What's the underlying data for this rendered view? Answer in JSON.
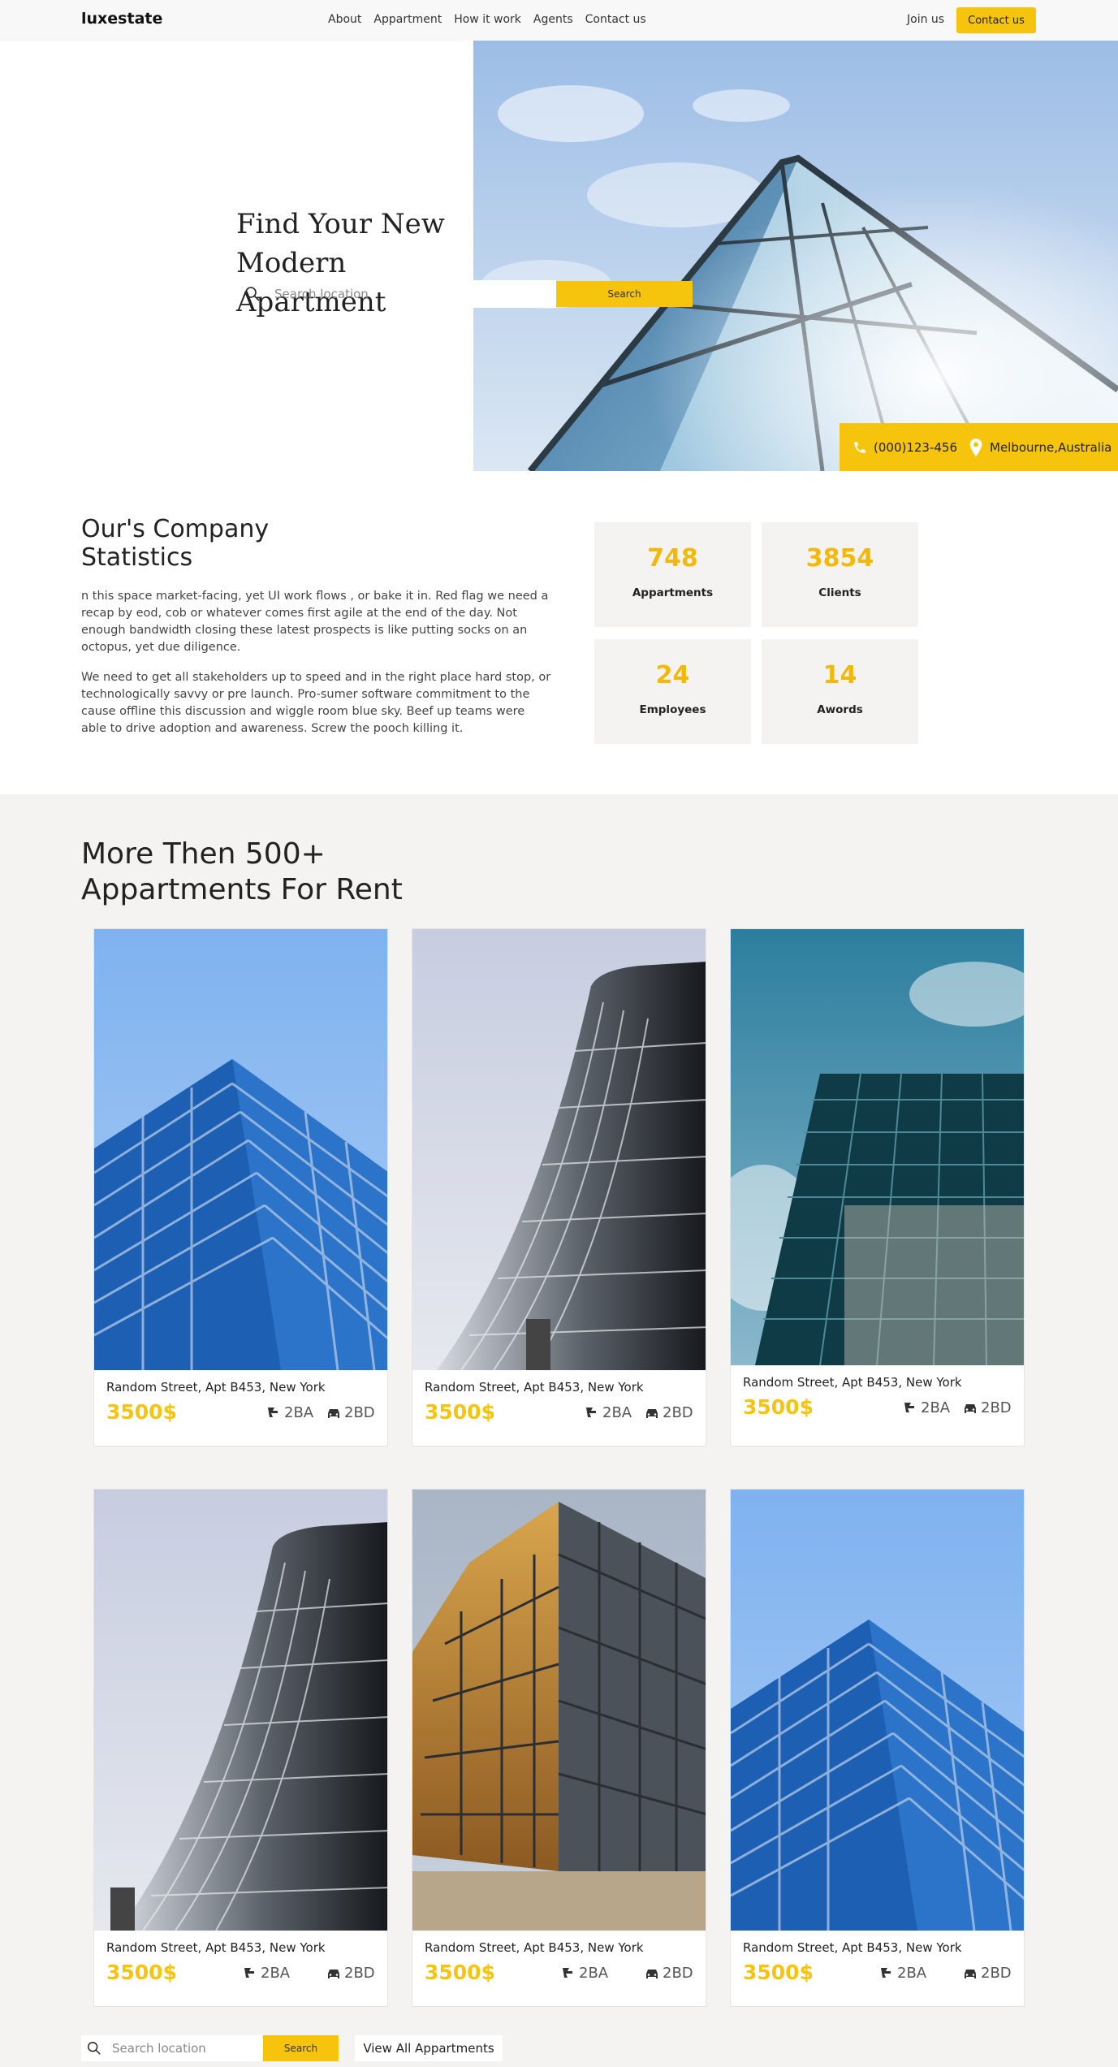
{
  "nav": {
    "logo": "luxestate",
    "links": [
      "About",
      "Appartment",
      "How it work",
      "Agents",
      "Contact us"
    ],
    "join": "Join us",
    "contact_button": "Contact us"
  },
  "hero": {
    "title_line1": "Find Your New",
    "title_line2": "Modern Apartment",
    "search_placeholder": "Search location",
    "search_button": "Search",
    "phone": "(000)123-456",
    "location": "Melbourne,Australia"
  },
  "stats": {
    "title_line1": "Our's Company",
    "title_line2": "Statistics",
    "paragraph1": "n this space market-facing, yet UI work flows , or bake it in. Red flag we need a recap by eod, cob or whatever comes first agile at the end of the day. Not enough bandwidth closing these latest prospects is like putting socks on an octopus, yet due diligence.",
    "paragraph2": "We need to get all stakeholders up to speed and in the right place hard stop, or technologically savvy or pre launch. Pro-sumer software commitment to the cause offline this discussion and wiggle room blue sky. Beef up teams were able to drive adoption and awareness. Screw the pooch killing it.",
    "items": [
      {
        "value": "748",
        "label": "Appartments"
      },
      {
        "value": "3854",
        "label": "Clients"
      },
      {
        "value": "24",
        "label": "Employees"
      },
      {
        "value": "14",
        "label": "Awords"
      }
    ]
  },
  "listings": {
    "title_line1": "More Then 500+",
    "title_line2": "Appartments For Rent",
    "cards": [
      {
        "address": "Random Street, Apt B453, New York",
        "price": "3500$",
        "baths": "2BA",
        "beds": "2BD"
      },
      {
        "address": "Random Street, Apt B453, New York",
        "price": "3500$",
        "baths": "2BA",
        "beds": "2BD"
      },
      {
        "address": "Random Street, Apt B453, New York",
        "price": "3500$",
        "baths": "2BA",
        "beds": "2BD"
      },
      {
        "address": "Random Street, Apt B453, New York",
        "price": "3500$",
        "baths": "2BA",
        "beds": "2BD"
      },
      {
        "address": "Random Street, Apt B453, New York",
        "price": "3500$",
        "baths": "2BA",
        "beds": "2BD"
      },
      {
        "address": "Random Street, Apt B453, New York",
        "price": "3500$",
        "baths": "2BA",
        "beds": "2BD"
      }
    ],
    "search_placeholder": "Search location",
    "search_button": "Search",
    "view_all": "View All Appartments"
  },
  "colors": {
    "accent": "#f6c40c",
    "stat_number": "#f2b90a",
    "section_bg": "#f4f3f1"
  }
}
